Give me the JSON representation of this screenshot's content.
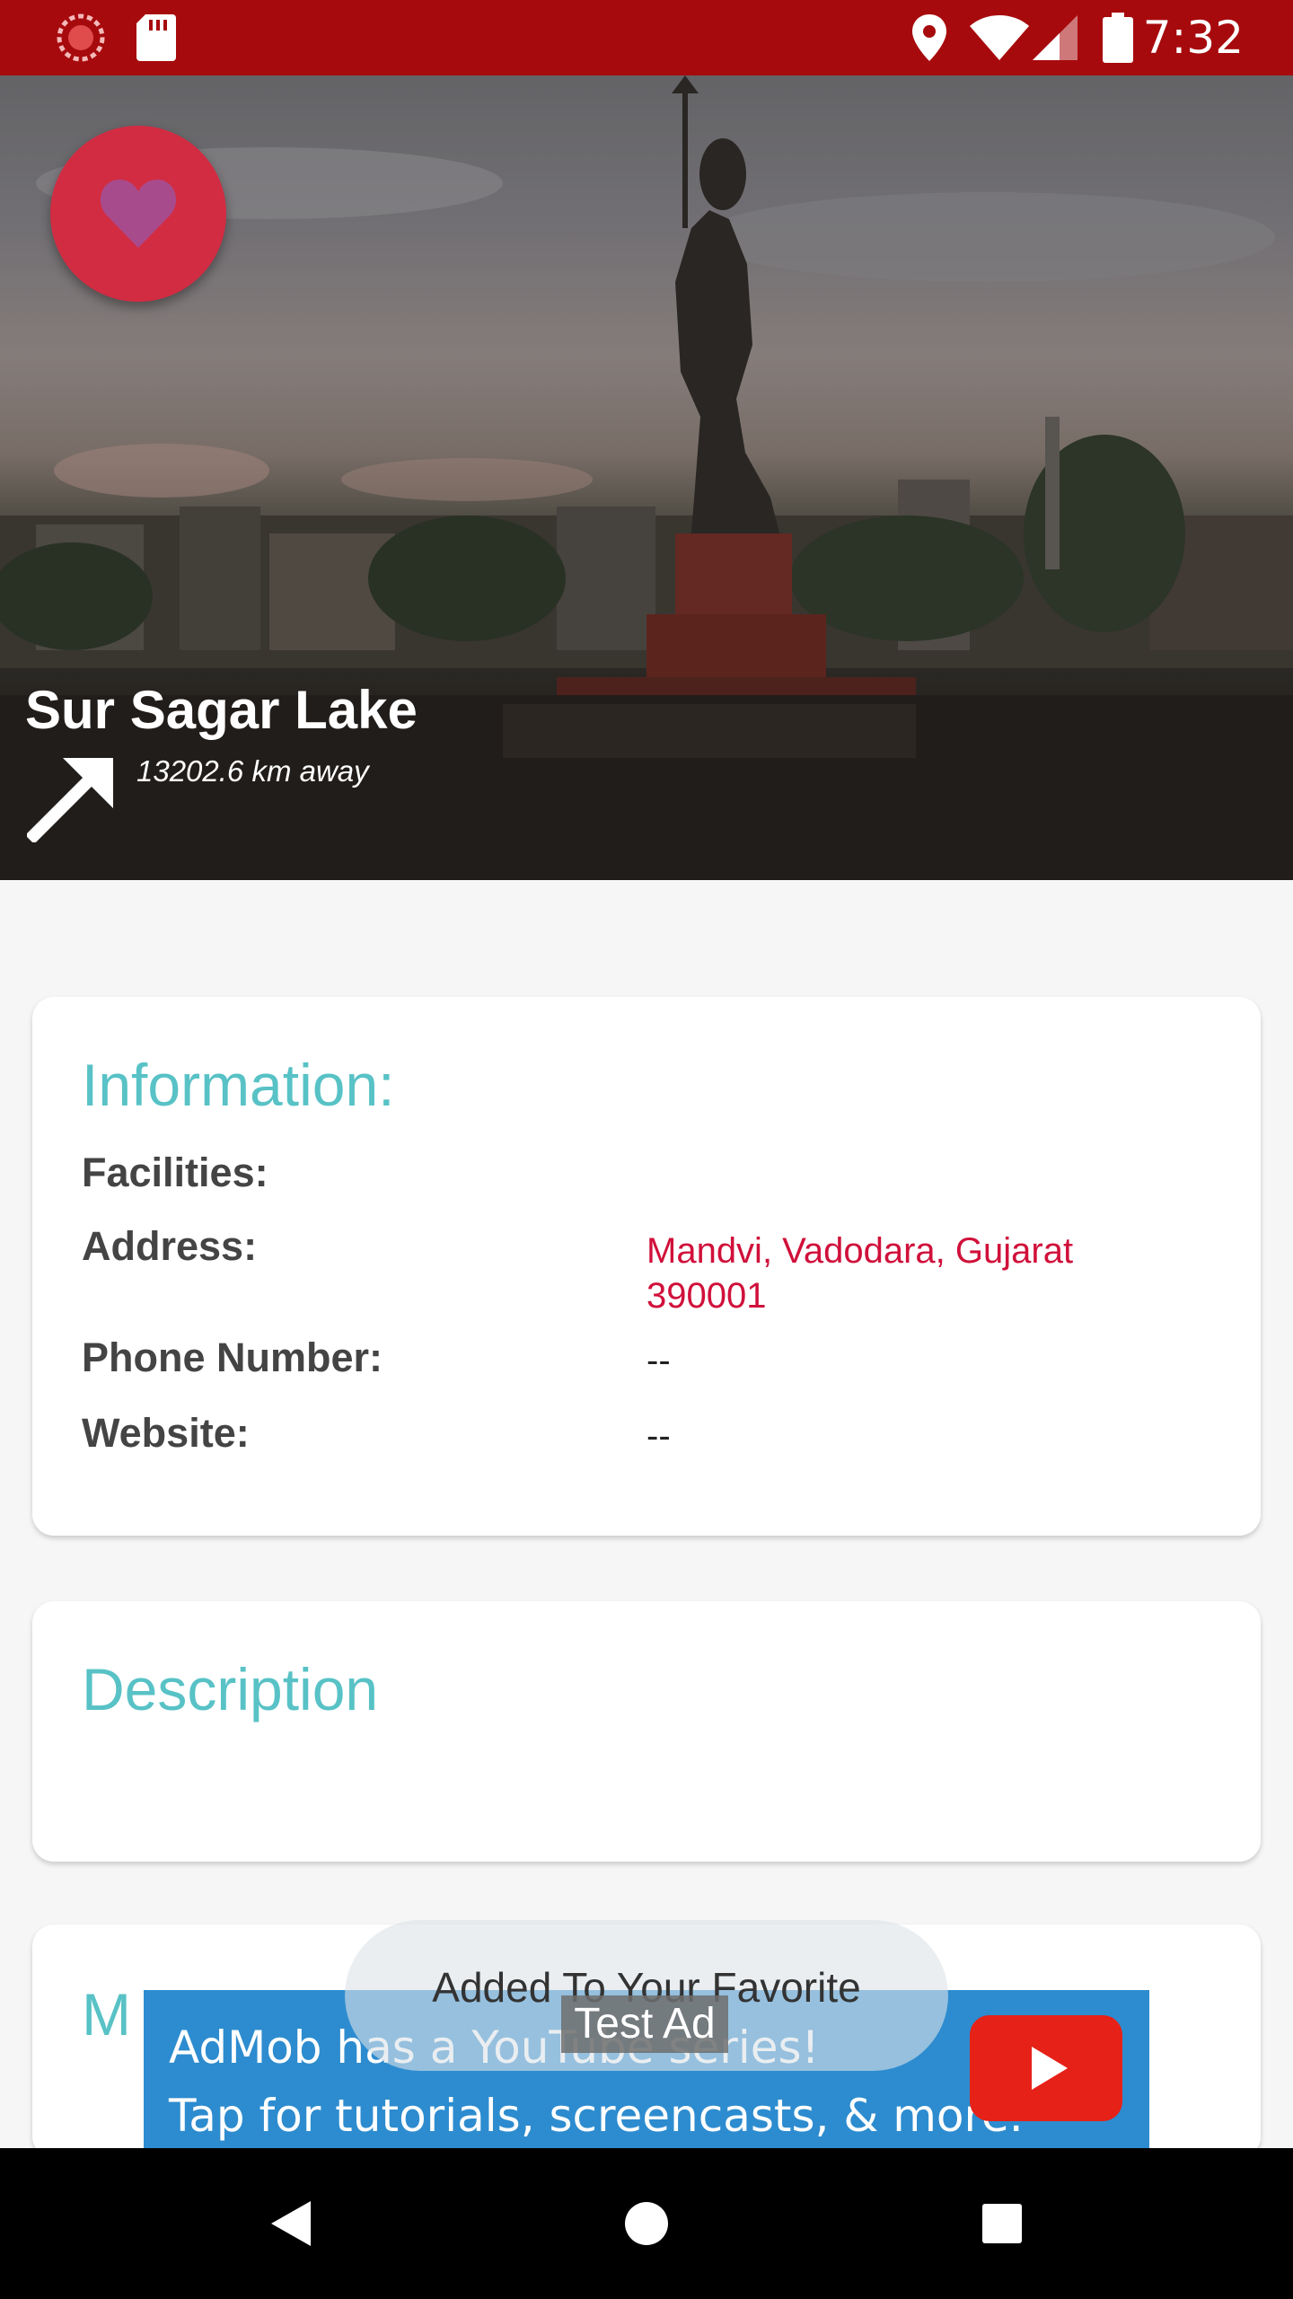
{
  "status_bar": {
    "time": "7:32",
    "background": "#a70a0d",
    "icons": [
      "loading-icon",
      "sd-card-icon",
      "location-icon",
      "wifi-icon",
      "signal-icon",
      "battery-icon"
    ]
  },
  "hero": {
    "title": "Sur Sagar Lake",
    "distance": "13202.6 km away",
    "favorite_icon": "heart-icon",
    "direction_icon": "arrow-up-right-icon",
    "fab_color": "#d22c42"
  },
  "information": {
    "heading": "Information:",
    "rows": [
      {
        "label": "Facilities:",
        "value": ""
      },
      {
        "label": "Address:",
        "value": "Mandvi, Vadodara, Gujarat 390001"
      },
      {
        "label": "Phone Number:",
        "value": "--"
      },
      {
        "label": "Website:",
        "value": "--"
      }
    ]
  },
  "description": {
    "heading": "Description",
    "body": ""
  },
  "next_card": {
    "heading_partial": "M"
  },
  "toast": {
    "text": "Added To Your Favorite"
  },
  "ad": {
    "line1": "AdMob has a YouTube series!",
    "line2": "Tap for tutorials, screencasts, & more.",
    "badge": "Test Ad",
    "icon": "youtube-play-icon",
    "background": "#2d8ccf"
  },
  "nav_bar": {
    "buttons": [
      "back-icon",
      "home-icon",
      "recents-icon"
    ]
  },
  "colors": {
    "accent_heading": "#58c2c6",
    "address_value": "#d0103a"
  }
}
